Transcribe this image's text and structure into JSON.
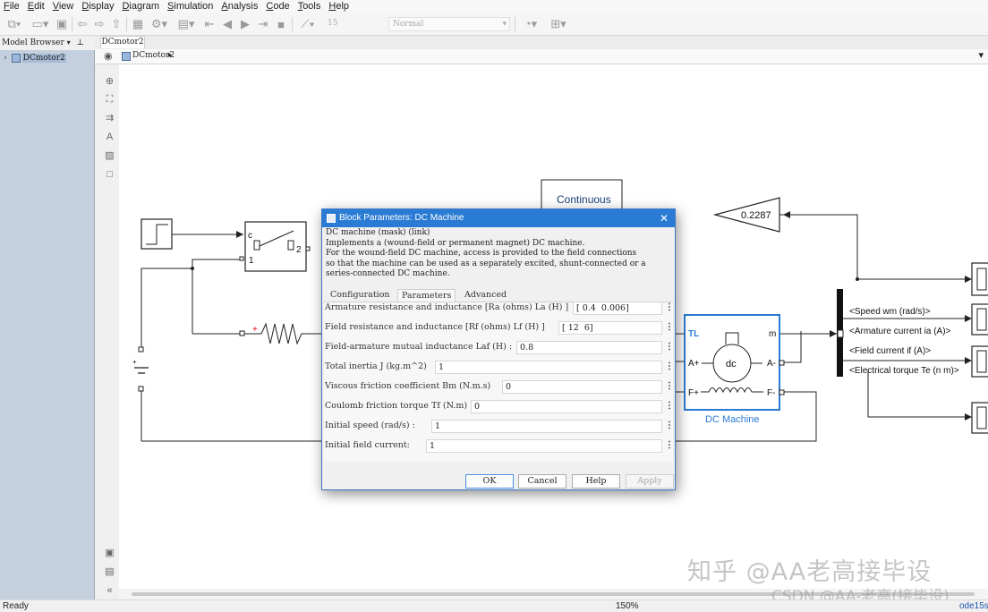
{
  "menu": [
    "File",
    "Edit",
    "View",
    "Display",
    "Diagram",
    "Simulation",
    "Analysis",
    "Code",
    "Tools",
    "Help"
  ],
  "toolbar": {
    "stop_time": "15",
    "sim_mode": "Normal"
  },
  "model_browser": {
    "title": "Model Browser",
    "tree_item": "DCmotor2"
  },
  "tab": {
    "label": "DCmotor2"
  },
  "address": {
    "path": "DCmotor2"
  },
  "diagram": {
    "continuous_label": "Continuous",
    "gain_value": "0.2287",
    "switch_port_c": "c",
    "switch_port_1": "1",
    "switch_port_2": "2",
    "battery_plus": "+",
    "dc_machine": {
      "name": "DC Machine",
      "tl": "TL",
      "m": "m",
      "a_plus": "A+",
      "a_minus": "A-",
      "f_plus": "F+",
      "f_minus": "F-",
      "center": "dc"
    },
    "bus_signals": [
      "<Speed wm (rad/s)>",
      "<Armature current ia (A)>",
      "<Field current if (A)>",
      "<Electrical torque Te (n m)>"
    ]
  },
  "dialog": {
    "title": "Block Parameters: DC Machine",
    "desc_line1": "DC machine (mask) (link)",
    "desc_line2": "Implements a (wound-field or permanent magnet) DC machine.",
    "desc_line3": "For the wound-field DC machine, access is provided to the field connections",
    "desc_line4": "so that the machine can be used as a separately excited, shunt-connected or a",
    "desc_line5": "series-connected  DC machine.",
    "tabs": [
      "Configuration",
      "Parameters",
      "Advanced"
    ],
    "active_tab": "Parameters",
    "params": [
      {
        "label": "Armature resistance and inductance [Ra (ohms) La (H) ]",
        "value": "[ 0.4  0.006]"
      },
      {
        "label": "Field resistance and inductance [Rf (ohms) Lf (H) ]",
        "value": "[ 12  6]"
      },
      {
        "label": "Field-armature mutual inductance Laf (H) :",
        "value": "0.8"
      },
      {
        "label": "Total inertia J (kg.m^2)",
        "value": "1"
      },
      {
        "label": "Viscous friction coefficient Bm (N.m.s)",
        "value": "0"
      },
      {
        "label": "Coulomb friction torque Tf (N.m)",
        "value": "0"
      },
      {
        "label": "Initial speed (rad/s) :",
        "value": "1"
      },
      {
        "label": "Initial field current:",
        "value": "1"
      }
    ],
    "buttons": {
      "ok": "OK",
      "cancel": "Cancel",
      "help": "Help",
      "apply": "Apply"
    }
  },
  "status": {
    "left": "Ready",
    "zoom": "150%",
    "solver": "ode15s"
  },
  "watermark": {
    "line1": "知乎 @AA老高接毕设",
    "line2": "CSDN @AA-老高(接毕设)"
  },
  "colors": {
    "dialog_title": "#2a7bd4",
    "dc_machine": "#2a7bd4",
    "model_browser": "#c4d0dd"
  }
}
